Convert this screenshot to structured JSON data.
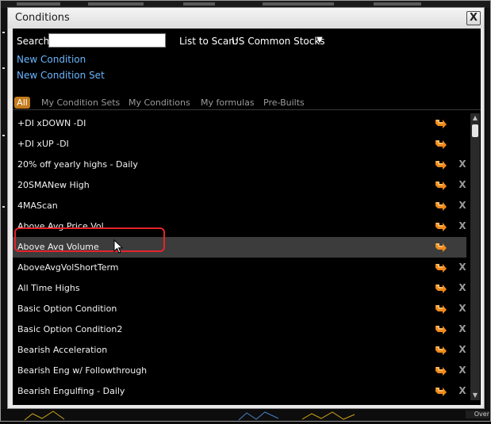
{
  "dialog": {
    "title": "Conditions",
    "close_label": "X"
  },
  "search": {
    "label": "Search",
    "value": "",
    "placeholder": ""
  },
  "scan": {
    "label": "List to Scan:",
    "value": "US Common Stocks",
    "caret": "▼"
  },
  "links": {
    "new_condition": "New Condition",
    "new_condition_set": "New Condition Set"
  },
  "tabs": [
    {
      "label": "All",
      "active": true
    },
    {
      "label": "My Condition Sets",
      "active": false
    },
    {
      "label": "My Conditions",
      "active": false
    },
    {
      "label": "My formulas",
      "active": false
    },
    {
      "label": "Pre-Builts",
      "active": false
    }
  ],
  "conditions": [
    {
      "label": "+DI xDOWN -DI",
      "deletable": false,
      "selected": false
    },
    {
      "label": "+DI xUP -DI",
      "deletable": false,
      "selected": false
    },
    {
      "label": "20% off yearly highs - Daily",
      "deletable": true,
      "selected": false
    },
    {
      "label": "20SMANew High",
      "deletable": true,
      "selected": false
    },
    {
      "label": "4MAScan",
      "deletable": true,
      "selected": false
    },
    {
      "label": "Above Avg Price Vol",
      "deletable": true,
      "selected": false
    },
    {
      "label": "Above Avg Volume",
      "deletable": false,
      "selected": true
    },
    {
      "label": "AboveAvgVolShortTerm",
      "deletable": true,
      "selected": false
    },
    {
      "label": "All Time Highs",
      "deletable": true,
      "selected": false
    },
    {
      "label": "Basic Option Condition",
      "deletable": true,
      "selected": false
    },
    {
      "label": "Basic Option Condition2",
      "deletable": true,
      "selected": false
    },
    {
      "label": "Bearish Acceleration",
      "deletable": true,
      "selected": false
    },
    {
      "label": "Bearish Eng w/ Followthrough",
      "deletable": true,
      "selected": false
    },
    {
      "label": "Bearish Engulfing - Daily",
      "deletable": true,
      "selected": false
    }
  ],
  "delete_label": "X",
  "icons": {
    "run": "run-condition-icon",
    "close": "close-icon",
    "scroll_up": "scroll-up-icon",
    "scroll_down": "scroll-down-icon",
    "cursor": "mouse-cursor-icon"
  },
  "colors": {
    "panel_bg": "#000000",
    "link": "#69b6ff",
    "active_tab": "#c47b1c",
    "selected_row": "#3c3c3c",
    "highlight": "#e5232a",
    "run_icon": "#f08a1a"
  },
  "background_corner_text": "Over"
}
